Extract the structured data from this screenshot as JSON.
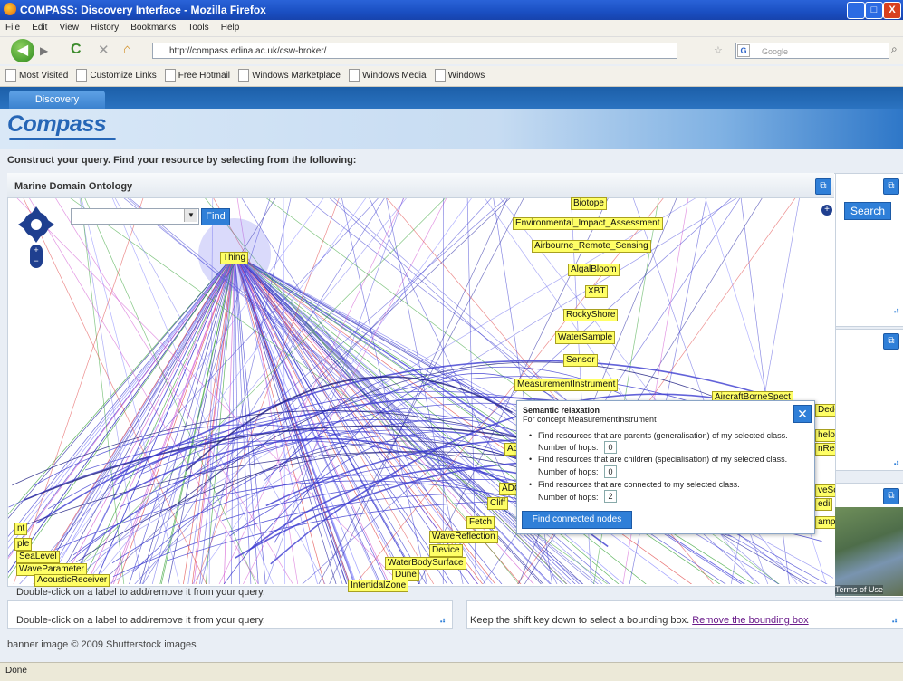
{
  "window": {
    "title": "COMPASS: Discovery Interface - Mozilla Firefox",
    "min": "_",
    "max": "□",
    "close": "X"
  },
  "menu": [
    "File",
    "Edit",
    "View",
    "History",
    "Bookmarks",
    "Tools",
    "Help"
  ],
  "nav": {
    "url": "http://compass.edina.ac.uk/csw-broker/",
    "search_placeholder": "Google"
  },
  "bookmarks": [
    "Most Visited",
    "Customize Links",
    "Free Hotmail",
    "Windows Marketplace",
    "Windows Media",
    "Windows"
  ],
  "page": {
    "tab": "Discovery",
    "logo": "Compass",
    "instructions": "Construct your query. Find your resource by selecting from the following:",
    "ontology_title": "Marine Domain Ontology",
    "find": "Find",
    "search": "Search",
    "hint": "Double-click on a label to add/remove it from your query.",
    "bbox_text": "Keep the shift key down to select a bounding box. ",
    "bbox_link": "Remove the bounding box",
    "footer": "banner image © 2009 Shutterstock images",
    "status": "Done",
    "map_terms": "Terms of Use"
  },
  "relaxation": {
    "title": "Semantic relaxation",
    "concept": "For concept MeasurementInstrument",
    "opt1": "Find resources that are parents (generalisation) of my selected class.",
    "opt2": "Find resources that are children (specialisation) of my selected class.",
    "opt3": "Find resources that are connected to my selected class.",
    "hops_label": "Number of hops:",
    "hops1": "0",
    "hops2": "0",
    "hops3": "2",
    "button": "Find connected nodes"
  },
  "nodes": [
    {
      "label": "Biotope"
    },
    {
      "label": "Environmental_Impact_Assessment"
    },
    {
      "label": "Airbourne_Remote_Sensing"
    },
    {
      "label": "AlgalBloom"
    },
    {
      "label": "XBT"
    },
    {
      "label": "RockyShore"
    },
    {
      "label": "WaterSample"
    },
    {
      "label": "Sensor"
    },
    {
      "label": "MeasurementInstrument"
    },
    {
      "label": "AircraftBorneSpect"
    },
    {
      "label": "Thing"
    },
    {
      "label": "Fetch"
    },
    {
      "label": "WaveReflection"
    },
    {
      "label": "Device"
    },
    {
      "label": "WaterBodySurface"
    },
    {
      "label": "Dune"
    },
    {
      "label": "IntertidalZone"
    },
    {
      "label": "SeaLevel"
    },
    {
      "label": "WaveParameter"
    },
    {
      "label": "AcousticReceiver"
    },
    {
      "label": "ple"
    },
    {
      "label": "nt"
    },
    {
      "label": "Cliff"
    },
    {
      "label": "ADC"
    },
    {
      "label": "Ac"
    },
    {
      "label": "Dede"
    },
    {
      "label": "helo"
    },
    {
      "label": "nRec"
    },
    {
      "label": "veSc"
    },
    {
      "label": "edi"
    },
    {
      "label": "amp"
    }
  ]
}
